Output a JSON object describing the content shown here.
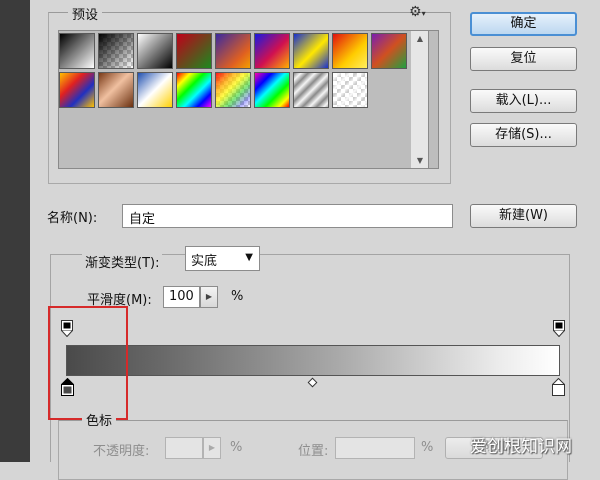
{
  "presets": {
    "title": "预设",
    "menu_icon": "gear-icon"
  },
  "buttons": {
    "ok": "确定",
    "reset": "复位",
    "load": "载入(L)...",
    "save": "存储(S)...",
    "new": "新建(W)"
  },
  "name": {
    "label": "名称(N):",
    "value": "自定"
  },
  "gradient": {
    "type_label": "渐变类型(T):",
    "type_value": "实底",
    "smoothness_label": "平滑度(M):",
    "smoothness_value": "100",
    "percent_sign": "%"
  },
  "color_stops": {
    "title": "色标",
    "opacity_label": "不透明度:",
    "opacity_unit": "%",
    "location_label": "位置:",
    "location_unit": "%",
    "delete_label": "删除(D)"
  },
  "watermark": "爱创根知识网",
  "colors": {
    "dialog_bg": "#d6d6d6",
    "highlight": "#d62a2a",
    "primary_border": "#4a8fd4"
  }
}
